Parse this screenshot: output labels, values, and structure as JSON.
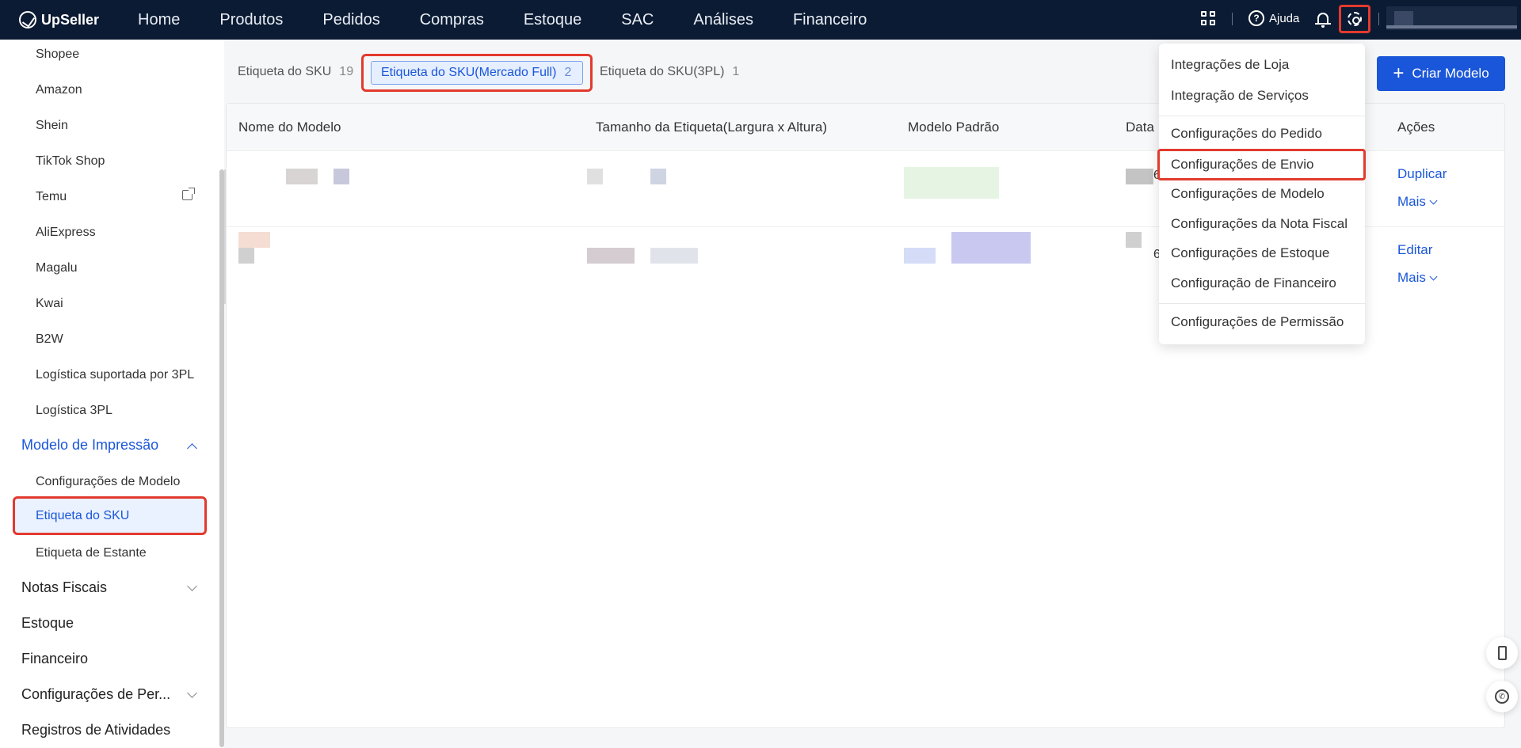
{
  "app": {
    "logo_text": "UpSeller"
  },
  "nav": [
    "Home",
    "Produtos",
    "Pedidos",
    "Compras",
    "Estoque",
    "SAC",
    "Análises",
    "Financeiro"
  ],
  "topbar": {
    "help_label": "Ajuda"
  },
  "sidebar": {
    "items": [
      "Shopee",
      "Amazon",
      "Shein",
      "TikTok Shop",
      "Temu",
      "AliExpress",
      "Magalu",
      "Kwai",
      "B2W",
      "Logística suportada por 3PL",
      "Logística 3PL"
    ],
    "group_print": "Modelo de Impressão",
    "print_sub": [
      "Configurações de Modelo",
      "Etiqueta do SKU",
      "Etiqueta de Estante"
    ],
    "groups_after": [
      "Notas Fiscais",
      "Estoque",
      "Financeiro",
      "Configurações de Per...",
      "Registros de Atividades"
    ]
  },
  "tabs": [
    {
      "label": "Etiqueta do SKU",
      "count": "19"
    },
    {
      "label": "Etiqueta do SKU(Mercado Full)",
      "count": "2"
    },
    {
      "label": "Etiqueta do SKU(3PL)",
      "count": "1"
    }
  ],
  "create_button": "Criar Modelo",
  "table": {
    "headers": [
      "Nome do Modelo",
      "Tamanho da Etiqueta(Largura x Altura)",
      "Modelo Padrão",
      "Data",
      "Ações"
    ],
    "rows": [
      {
        "date_fragment": "6",
        "action1": "Duplicar",
        "action2": "Mais"
      },
      {
        "date_fragment": "6",
        "action1": "Editar",
        "action2": "Mais"
      }
    ]
  },
  "settings_menu": {
    "items": [
      "Integrações de Loja",
      "Integração de Serviços",
      "Configurações do Pedido",
      "Configurações de Envio",
      "Configurações de Modelo",
      "Configurações da Nota Fiscal",
      "Configurações de Estoque",
      "Configuração de Financeiro",
      "Configurações de Permissão"
    ]
  },
  "colors": {
    "nav_bg": "#0b1b33",
    "accent": "#1a56d9",
    "highlight": "#e23a2e"
  },
  "icons": [
    "apps-grid-icon",
    "help-icon",
    "bell-icon",
    "gear-icon",
    "external-link-icon",
    "phone-icon",
    "whatsapp-icon"
  ]
}
